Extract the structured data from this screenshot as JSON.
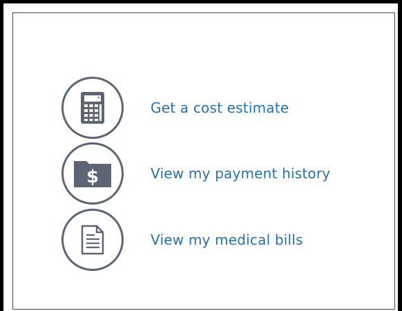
{
  "actions": [
    {
      "label": "Get a cost estimate",
      "icon": "calculator-icon"
    },
    {
      "label": "View my payment history",
      "icon": "dollar-folder-icon"
    },
    {
      "label": "View my medical bills",
      "icon": "document-icon"
    }
  ],
  "colors": {
    "link": "#1f73b5",
    "icon_stroke": "#5d6575",
    "icon_fill": "#5d6575"
  }
}
